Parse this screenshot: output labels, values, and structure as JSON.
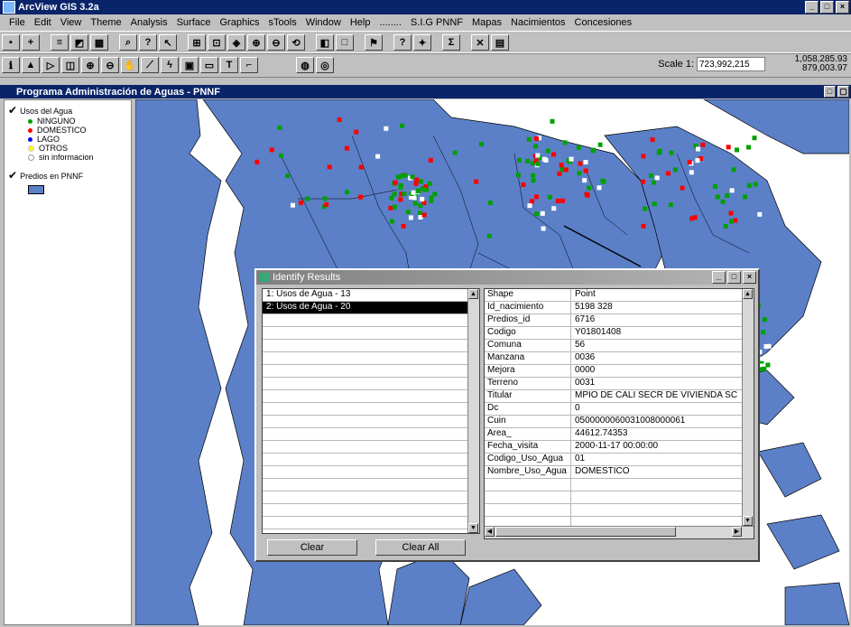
{
  "app": {
    "title": "ArcView GIS 3.2a"
  },
  "menu": [
    "File",
    "Edit",
    "View",
    "Theme",
    "Analysis",
    "Surface",
    "Graphics",
    "sTools",
    "Window",
    "Help",
    "........",
    "S.I.G PNNF",
    "Mapas",
    "Nacimientos",
    "Concesiones"
  ],
  "scale": {
    "label": "Scale 1:",
    "value": "723,992,215"
  },
  "coords": {
    "x": "1,058,285.93",
    "y": "879,003.97"
  },
  "view": {
    "title": "Programa Administración de Aguas - PNNF"
  },
  "toc": {
    "theme1": "Usos del Agua",
    "legend": [
      {
        "label": "NINGUNO",
        "color": "#00a000"
      },
      {
        "label": "DOMESTICO",
        "color": "#ff0000"
      },
      {
        "label": "LAGO",
        "color": "#0000ff"
      },
      {
        "label": "OTROS",
        "color": "#ffff00"
      },
      {
        "label": "sin informacion",
        "color": "#ffffff"
      }
    ],
    "theme2": "Predios en PNNF"
  },
  "identify": {
    "title": "Identify Results",
    "results": [
      "1: Usos de Agua - 13",
      "2: Usos de Agua - 20"
    ],
    "selected_index": 1,
    "clear_label": "Clear",
    "clear_all_label": "Clear All",
    "attributes": [
      {
        "k": "Shape",
        "v": "Point"
      },
      {
        "k": "Id_nacimiento",
        "v": "5198 328"
      },
      {
        "k": "Predios_id",
        "v": "6716"
      },
      {
        "k": "Codigo",
        "v": "Y01801408"
      },
      {
        "k": "Comuna",
        "v": "56"
      },
      {
        "k": "Manzana",
        "v": "0036"
      },
      {
        "k": "Mejora",
        "v": "0000"
      },
      {
        "k": "Terreno",
        "v": "0031"
      },
      {
        "k": "Titular",
        "v": "MPIO DE CALI SECR DE VIVIENDA SC"
      },
      {
        "k": "Dc",
        "v": "0"
      },
      {
        "k": "Cuin",
        "v": "0500000060031008000061"
      },
      {
        "k": "Area_",
        "v": "44612.74353"
      },
      {
        "k": "Fecha_visita",
        "v": "2000-11-17 00:00:00"
      },
      {
        "k": "Codigo_Uso_Agua",
        "v": "01"
      },
      {
        "k": "Nombre_Uso_Agua",
        "v": "DOMESTICO"
      }
    ]
  }
}
